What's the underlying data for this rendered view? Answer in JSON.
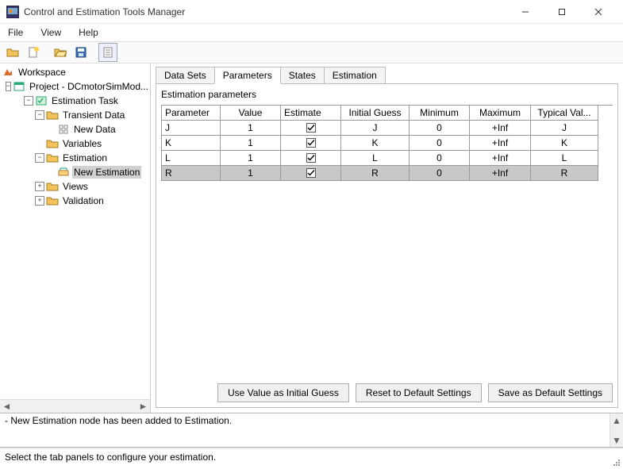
{
  "window": {
    "title": "Control and Estimation Tools Manager"
  },
  "menu": {
    "file": "File",
    "view": "View",
    "help": "Help"
  },
  "tree": {
    "root": "Workspace",
    "project": "Project - DCmotorSimMod...",
    "task": "Estimation Task",
    "transient": "Transient Data",
    "newdata": "New Data",
    "variables": "Variables",
    "estimation": "Estimation",
    "newest": "New Estimation",
    "views": "Views",
    "validation": "Validation"
  },
  "tabs": {
    "datasets": "Data Sets",
    "parameters": "Parameters",
    "states": "States",
    "estimation": "Estimation"
  },
  "section_label": "Estimation parameters",
  "columns": {
    "parameter": "Parameter",
    "value": "Value",
    "estimate": "Estimate",
    "initial_guess": "Initial Guess",
    "minimum": "Minimum",
    "maximum": "Maximum",
    "typical": "Typical Val..."
  },
  "rows": [
    {
      "param": "J",
      "value": "1",
      "est": true,
      "ig": "J",
      "min": "0",
      "max": "+Inf",
      "typ": "J"
    },
    {
      "param": "K",
      "value": "1",
      "est": true,
      "ig": "K",
      "min": "0",
      "max": "+Inf",
      "typ": "K"
    },
    {
      "param": "L",
      "value": "1",
      "est": true,
      "ig": "L",
      "min": "0",
      "max": "+Inf",
      "typ": "L"
    },
    {
      "param": "R",
      "value": "1",
      "est": true,
      "ig": "R",
      "min": "0",
      "max": "+Inf",
      "typ": "R"
    }
  ],
  "buttons": {
    "use_value": "Use Value as Initial Guess",
    "reset": "Reset to Default Settings",
    "save": "Save as Default Settings"
  },
  "log": {
    "line1_truncated": "",
    "line2": "- New Estimation node has been added to Estimation."
  },
  "status": "Select the tab panels to configure your estimation."
}
